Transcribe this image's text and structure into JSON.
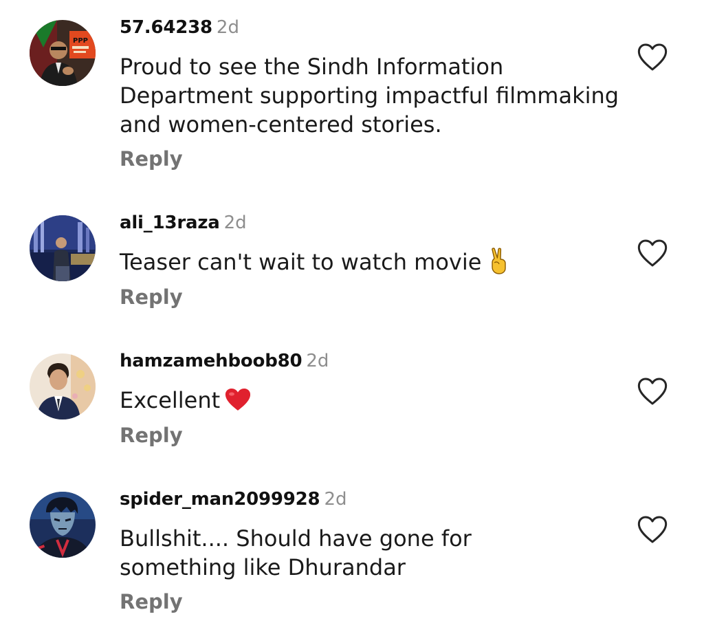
{
  "comments": [
    {
      "username": "57.64238",
      "time": "2d",
      "text": "Proud to see the Sindh Information Department supporting impactful filmmaking and women-centered stories.",
      "reply_label": "Reply",
      "avatar_badge": "PPP"
    },
    {
      "username": "ali_13raza",
      "time": "2d",
      "text": "Teaser can't wait to watch movie",
      "emoji": "victory-hand-emoji",
      "reply_label": "Reply"
    },
    {
      "username": "hamzamehboob80",
      "time": "2d",
      "text": "Excellent",
      "emoji": "red-heart-emoji",
      "reply_label": "Reply"
    },
    {
      "username": "spider_man2099928",
      "time": "2d",
      "text": "Bullshit.... Should have gone for something like Dhurandar",
      "reply_label": "Reply"
    }
  ],
  "colors": {
    "text": "#111111",
    "muted": "#8e8e8e",
    "reply": "#737373",
    "heart_outline": "#262626",
    "emoji_heart": "#e0212e",
    "emoji_hand": "#f6c12f"
  },
  "icons": {
    "like": "heart-outline-icon"
  }
}
